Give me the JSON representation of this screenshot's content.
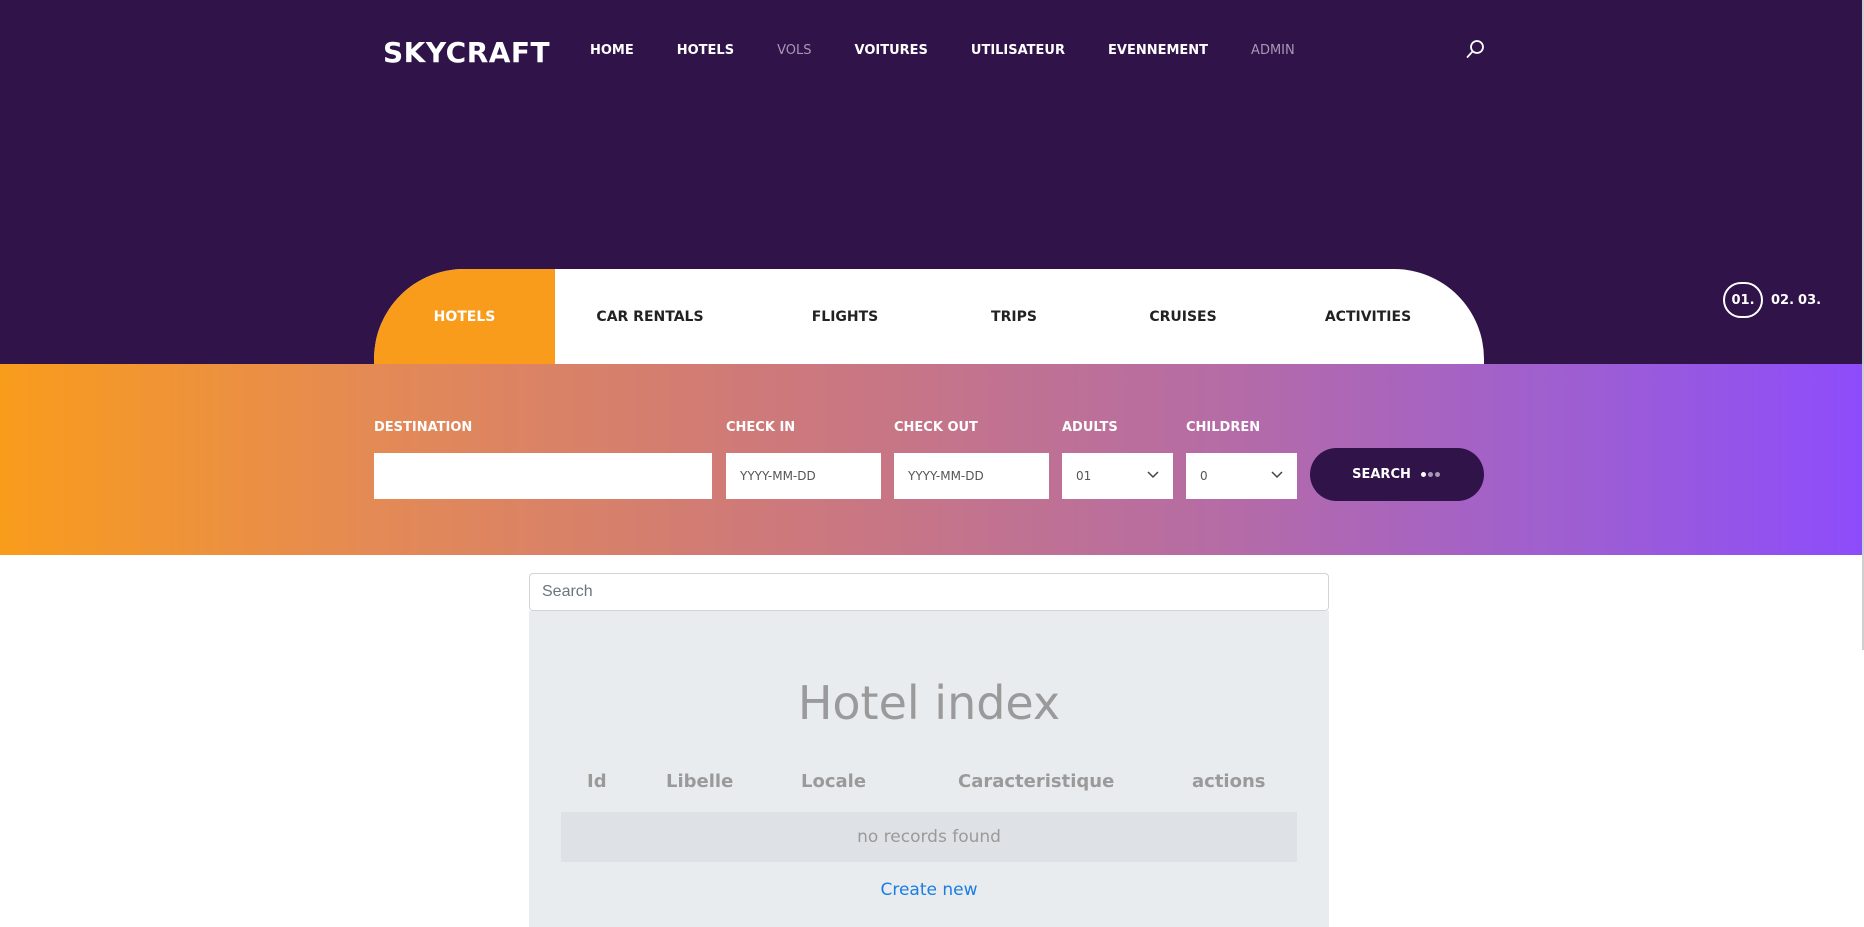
{
  "header": {
    "logo": "SKYCRAFT",
    "nav": [
      {
        "label": "HOME",
        "dim": false
      },
      {
        "label": "HOTELS",
        "dim": false
      },
      {
        "label": "VOLS",
        "dim": true
      },
      {
        "label": "VOITURES",
        "dim": false
      },
      {
        "label": "UTILISATEUR",
        "dim": false
      },
      {
        "label": "EVENNEMENT",
        "dim": false
      },
      {
        "label": "ADMIN",
        "dim": true
      }
    ],
    "search_icon": "search-icon"
  },
  "slider_pager": {
    "active": "01.",
    "others": [
      "02.",
      "03."
    ]
  },
  "tabs": [
    "HOTELS",
    "CAR RENTALS",
    "FLIGHTS",
    "TRIPS",
    "CRUISES",
    "ACTIVITIES"
  ],
  "booking_form": {
    "destination_label": "DESTINATION",
    "destination_value": "",
    "checkin_label": "CHECK IN",
    "checkin_placeholder": "YYYY-MM-DD",
    "checkout_label": "CHECK OUT",
    "checkout_placeholder": "YYYY-MM-DD",
    "adults_label": "ADULTS",
    "adults_value": "01",
    "children_label": "CHILDREN",
    "children_value": "0",
    "search_label": "SEARCH"
  },
  "list": {
    "search_placeholder": "Search",
    "title": "Hotel index",
    "columns": [
      "Id",
      "Libelle",
      "Locale",
      "Caracteristique",
      "actions"
    ],
    "empty_text": "no records found",
    "create_label": "Create new"
  },
  "colors": {
    "header_bg": "#2f1349",
    "accent_orange": "#f99c1c",
    "accent_purple": "#8d4cfb",
    "link_blue": "#1a7de3"
  }
}
